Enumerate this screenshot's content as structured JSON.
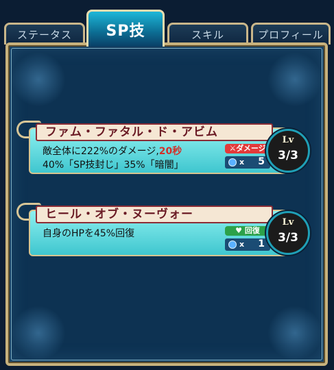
{
  "tabs": [
    {
      "label": "ステータス",
      "active": false
    },
    {
      "label": "SP技",
      "active": true
    },
    {
      "label": "スキル",
      "active": false
    },
    {
      "label": "プロフィール",
      "active": false
    }
  ],
  "skills": [
    {
      "name": "ファム・ファタル・ド・アビム",
      "desc_line1": "敵全体に222%のダメージ,",
      "desc_line1_highlight": "20秒",
      "desc_line2": "40%「SP技封じ」35%「暗闇」",
      "tag": "ダメージ",
      "tag_color": "#e23a3a",
      "cost_x": "x",
      "cost": "5",
      "level_label": "Lv",
      "level": "3/3"
    },
    {
      "name": "ヒール・オブ・ヌーヴォー",
      "desc_line1": "自身のHPを45%回復",
      "tag": "回復",
      "tag_color": "#2ca14a",
      "cost_x": "x",
      "cost": "1",
      "level_label": "Lv",
      "level": "3/3"
    }
  ],
  "colors": {
    "panel": "#0d3252",
    "frame": "#c8b27d",
    "bar": "#3fc6cf",
    "title_text": "#6a1a24"
  }
}
